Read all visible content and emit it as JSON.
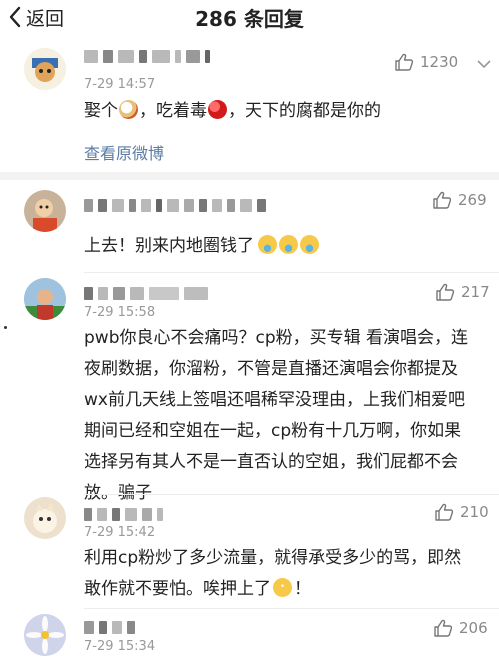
{
  "topbar": {
    "back_label": "返回",
    "title": "286 条回复"
  },
  "main_post": {
    "time": "7-29 14:57",
    "likes": "1230",
    "text_before": "娶个",
    "text_mid": "，吃着毒",
    "text_after": "，天下的腐都是你的",
    "link": "查看原微博"
  },
  "replies": [
    {
      "time": "",
      "likes": "269",
      "text": "上去！别来内地圈钱了"
    },
    {
      "time": "7-29 15:58",
      "likes": "217",
      "lines": [
        "pwb你良心不会痛吗？cp粉，买专辑 看演唱会，连",
        "夜刷数据，你溜粉，不管是直播还演唱会你都提及",
        "wx前几天线上签唱还唱稀罕没理由，上我们相爱吧",
        "期间已经和空姐在一起，cp粉有十几万啊，你如果",
        "选择另有其人不是一直否认的空姐，我们屁都不会",
        "放。骗子"
      ]
    },
    {
      "time": "7-29 15:42",
      "likes": "210",
      "lines": [
        "利用cp粉炒了多少流量，就得承受多少的骂，即然",
        "敢作就不要怕。唉押上了",
        "！"
      ]
    },
    {
      "time": "7-29 15:34",
      "likes": "206"
    }
  ],
  "colors": {
    "link": "#5b7da5",
    "meta": "#999999",
    "divider": "#f2f2f2"
  }
}
